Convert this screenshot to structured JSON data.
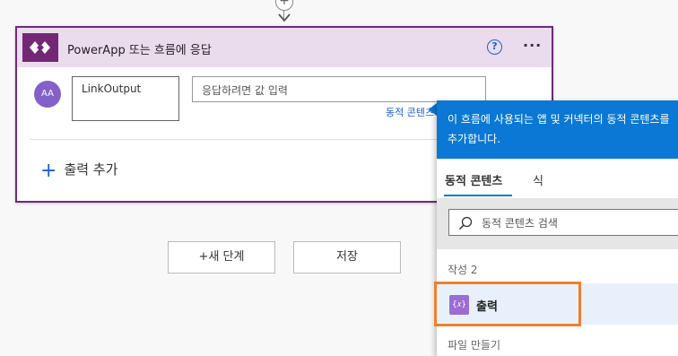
{
  "connector": {
    "add_symbol": "+"
  },
  "card": {
    "title": "PowerApp 또는 흐름에 응답",
    "help_symbol": "?",
    "more_symbol": "···",
    "avatar_text": "AA",
    "output_name": "LinkOutput",
    "value_placeholder": "응답하려면 값 입력",
    "dynamic_content_link": "동적 콘텐츠",
    "add_output_plus": "+",
    "add_output_label": "출력 추가"
  },
  "buttons": {
    "new_step": "+새 단계",
    "save": "저장"
  },
  "flyout": {
    "banner_line1": "이 흐름에 사용되는 앱 및 커넥터의 동적 콘텐츠를",
    "banner_line2": "추가합니다.",
    "tabs": [
      {
        "label": "동적 콘텐츠",
        "active": true
      },
      {
        "label": "식",
        "active": false
      }
    ],
    "search_placeholder": "동적 콘텐츠 검색",
    "section_create": "작성 2",
    "item_icon_text": "{𝑥}",
    "item_label": "출력",
    "section_file": "파일 만들기"
  },
  "colors": {
    "accent_blue": "#0a78d4",
    "header_purple": "#742774",
    "highlight_orange": "#f07f2c"
  },
  "icons": [
    "add-circle-icon",
    "arrow-down-icon",
    "powerapps-icon",
    "help-icon",
    "more-icon",
    "search-icon",
    "variable-icon"
  ]
}
